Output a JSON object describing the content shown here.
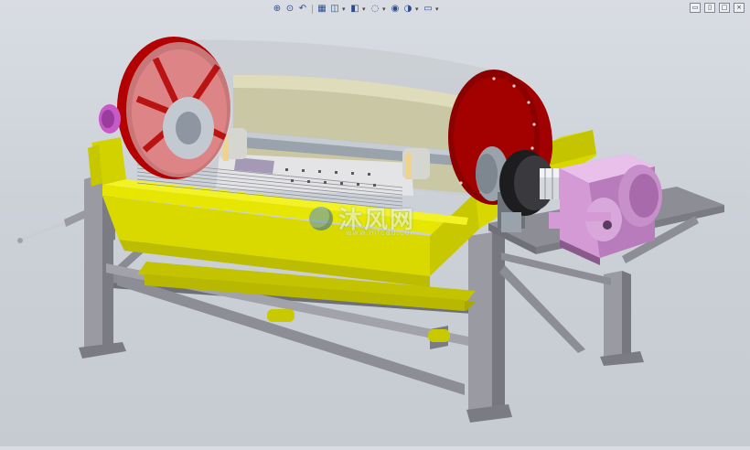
{
  "toolbar": {
    "icons": [
      {
        "name": "zoom-to-fit-icon",
        "glyph": "⊕"
      },
      {
        "name": "zoom-to-area-icon",
        "glyph": "⊙"
      },
      {
        "name": "previous-view-icon",
        "glyph": "↶"
      },
      {
        "name": "section-view-icon",
        "glyph": "▦"
      },
      {
        "name": "view-orientation-icon",
        "glyph": "◫"
      },
      {
        "name": "display-style-icon",
        "glyph": "◧"
      },
      {
        "name": "hide-show-items-icon",
        "glyph": "◌"
      },
      {
        "name": "edit-appearance-icon",
        "glyph": "◉"
      },
      {
        "name": "apply-scene-icon",
        "glyph": "◑"
      },
      {
        "name": "view-settings-icon",
        "glyph": "▭"
      }
    ]
  },
  "window_controls": [
    {
      "name": "restore-view-icon",
      "glyph": "▭"
    },
    {
      "name": "tile-view-icon",
      "glyph": "▯"
    },
    {
      "name": "maximize-view-icon",
      "glyph": "□"
    },
    {
      "name": "close-view-icon",
      "glyph": "×"
    }
  ],
  "watermark": {
    "text": "沐风网",
    "subtext": "www.mfcad.com"
  },
  "colors": {
    "background": "#cdd2d9",
    "frame": "#8f8f96",
    "tank": "#d9d900",
    "flange": "#a80000",
    "drum": "#c2c7ae",
    "gearbox": "#d49ad6",
    "shaft": "#9aa2ab"
  }
}
